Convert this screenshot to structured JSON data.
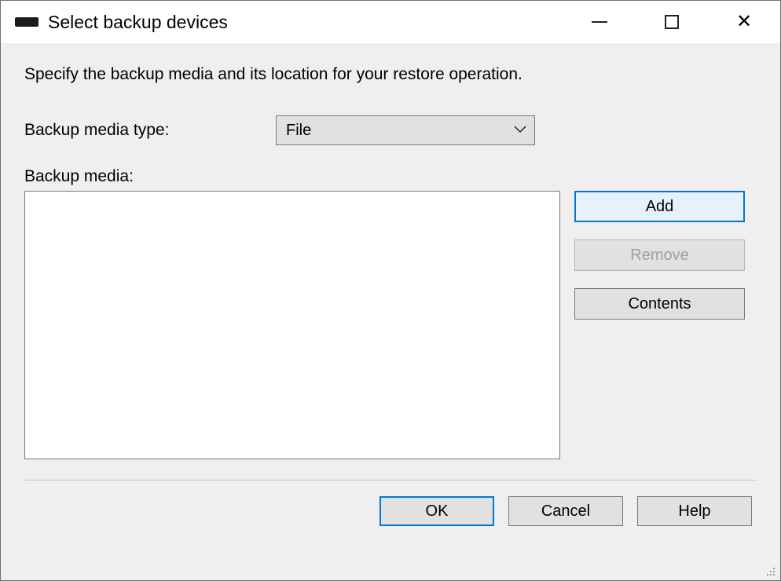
{
  "title": "Select backup devices",
  "instruction": "Specify the backup media and its location for your restore operation.",
  "media_type_label": "Backup media type:",
  "media_type_value": "File",
  "media_list_label": "Backup media:",
  "buttons": {
    "add": "Add",
    "remove": "Remove",
    "contents": "Contents",
    "ok": "OK",
    "cancel": "Cancel",
    "help": "Help"
  }
}
